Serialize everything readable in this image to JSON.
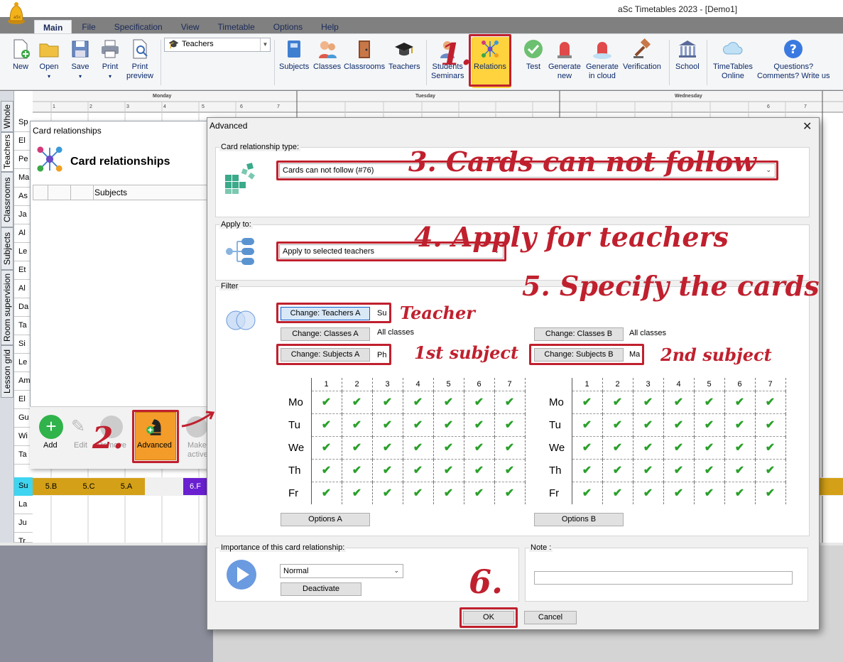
{
  "app": {
    "title": "aSc Timetables 2023  - [Demo1]"
  },
  "menu_tabs": [
    "Main",
    "File",
    "Specification",
    "View",
    "Timetable",
    "Options",
    "Help"
  ],
  "ribbon": {
    "new": "New",
    "open": "Open",
    "save": "Save",
    "print": "Print",
    "print_preview_1": "Print",
    "print_preview_2": "preview",
    "teacher_select": "Teachers",
    "subjects": "Subjects",
    "classes": "Classes",
    "classrooms": "Classrooms",
    "teachers": "Teachers",
    "students_1": "Students",
    "students_2": "Seminars",
    "relations": "Relations",
    "test": "Test",
    "generate_new_1": "Generate",
    "generate_new_2": "new",
    "generate_cloud_1": "Generate",
    "generate_cloud_2": "in cloud",
    "verification": "Verification",
    "school": "School",
    "tt_online_1": "TimeTables",
    "tt_online_2": "Online",
    "questions_1": "Questions?",
    "questions_2": "Comments? Write us"
  },
  "grid": {
    "days": [
      "Monday",
      "Tuesday",
      "Wednesday"
    ],
    "periods": [
      "1",
      "2",
      "3",
      "4",
      "5",
      "6",
      "7"
    ],
    "rows": [
      "Sp",
      "El",
      "Pe",
      "Ma",
      "As",
      "Ja",
      "Al",
      "Le",
      "Et",
      "Al",
      "Da",
      "Ta",
      "Si",
      "Le",
      "Am",
      "El",
      "Gu",
      "Wi",
      "Ta",
      "Su",
      "La",
      "Ju",
      "Tr"
    ],
    "su_cells": [
      "5.B",
      "5.C",
      "5.A",
      "6.F"
    ],
    "vertical_tabs": [
      "Whole",
      "Teachers",
      "Classrooms",
      "Subjects",
      "Room supervision",
      "Lesson grid"
    ]
  },
  "card_relationships": {
    "window_title": "Card relationships",
    "heading": "Card relationships",
    "col_subjects": "Subjects",
    "add": "Add",
    "edit": "Edit",
    "remove": "Remove",
    "advanced": "Advanced",
    "make_active_1": "Make",
    "make_active_2": "active"
  },
  "advanced": {
    "title": "Advanced",
    "type_label": "Card relationship type:",
    "type_value": "Cards can not follow (#76)",
    "apply_label": "Apply to:",
    "apply_value": "Apply to selected teachers",
    "filter_label": "Filter",
    "change_teachers_a": "Change: Teachers A",
    "teachers_a_value": "Su",
    "change_classes_a": "Change: Classes A",
    "classes_a_value": "All classes",
    "change_subjects_a": "Change: Subjects A",
    "subjects_a_value": "Ph",
    "change_classes_b": "Change: Classes B",
    "classes_b_value": "All classes",
    "change_subjects_b": "Change: Subjects B",
    "subjects_b_value": "Ma",
    "period_numbers": [
      "1",
      "2",
      "3",
      "4",
      "5",
      "6",
      "7"
    ],
    "days": [
      "Mo",
      "Tu",
      "We",
      "Th",
      "Fr"
    ],
    "options_a": "Options A",
    "options_b": "Options B",
    "importance_label": "Importance of this card relationship:",
    "importance_value": "Normal",
    "deactivate": "Deactivate",
    "note_label": "Note :",
    "ok": "OK",
    "cancel": "Cancel"
  },
  "annotations": {
    "step1": "1.",
    "step2": "2.",
    "step3": "3. Cards can not follow",
    "step4": "4. Apply for teachers",
    "step5": "5. Specify the cards",
    "step6": "6.",
    "teacher": "Teacher",
    "first_subject": "1st subject",
    "second_subject": "2nd subject"
  },
  "colors": {
    "accent_red": "#c0202e",
    "check_green": "#2aa02a",
    "relations_highlight": "#ffd33d",
    "cell_gold": "#d4a017",
    "cell_purple": "#6a1fd0"
  }
}
